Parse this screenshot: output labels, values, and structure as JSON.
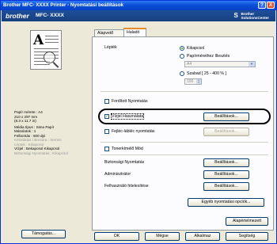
{
  "window": {
    "title": "Brother MFC- XXXX  Printer - Nyomtatási beállítások",
    "help_label": "?",
    "close_label": "X"
  },
  "brand": {
    "logo": "brother",
    "model": "MFC- XXXX",
    "solutions_line1": "Brother",
    "solutions_line2": "SolutionsCenter",
    "solutions_icon": "S"
  },
  "preview": {
    "letter": "A"
  },
  "info": {
    "lines": [
      "Papír mérete : A4",
      "210 x 297 mm",
      "(8.3 x 11.7 in)",
      "",
      "Média típus : Sima Papír",
      "Másolatok : 1",
      "Felbontás : 600 dpi",
      "Kétoldalas / Brosúra : Semmi",
      "Léptek : Kikapcsol",
      "Vízjel : Bekapcsol Kikapcsol",
      "Biztonsági Nyomtatás : Kikapcsol"
    ]
  },
  "left_button": "Támogatás...",
  "tabs": [
    {
      "label": "Alapvető",
      "active": false
    },
    {
      "label": "Haladó",
      "active": true
    }
  ],
  "scaling": {
    "label": "Lépték",
    "options": [
      "Kikapcsol",
      "Papírmérethez Illesztés",
      "Szabad [ 25 - 400 % ]"
    ],
    "selected": 0,
    "paper_select": "A4",
    "percent_value": "100"
  },
  "checks": {
    "reverse_print": "Fordított Nyomtatás",
    "watermark": "Vízjel Használata",
    "header_footer": "Fejléc-lábléc nyomtatás",
    "toner_save": "Tonerkímélő Mód"
  },
  "rows": {
    "security": "Biztonsági Nyomtatás",
    "administrator": "Adminisztrátor",
    "user_auth": "Felhasználó hitelesítése"
  },
  "buttons": {
    "settings": "Beállítások...",
    "other_print_options": "Egyéb nyomtatási opciók...",
    "defaults": "Alapértelmezett",
    "ok": "OK",
    "cancel": "Mégse",
    "apply": "Alkalmaz",
    "help": "Segítség"
  },
  "colors": {
    "accent_orange": "#e68b2c",
    "title_blue": "#0a4fd6",
    "brand_bar": "#1f4f9a"
  }
}
